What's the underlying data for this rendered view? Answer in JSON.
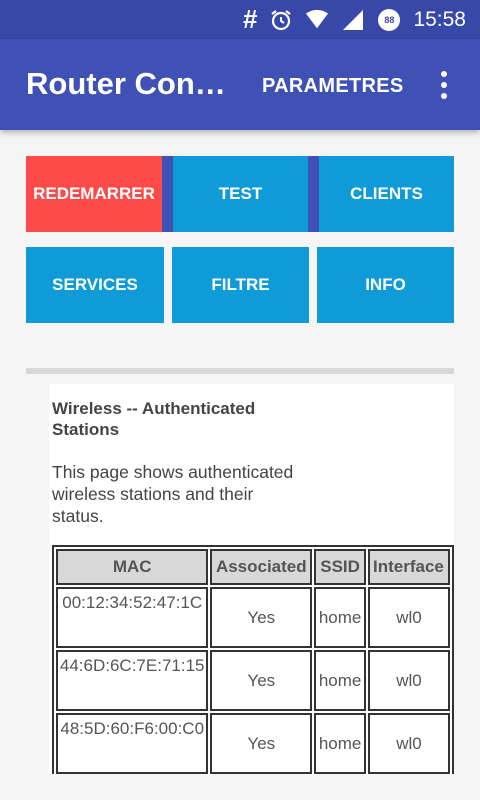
{
  "status_bar": {
    "notification_icon": "#",
    "battery_level": "88",
    "time": "15:58",
    "icons": [
      "hash-notification-icon",
      "alarm-icon",
      "wifi-icon",
      "cell-signal-icon",
      "battery-icon"
    ]
  },
  "app_bar": {
    "title": "Router Cont…",
    "action": "PARAMETRES",
    "overflow_icon": "more-vert-icon",
    "color": "#3f51b5"
  },
  "buttons": [
    {
      "label": "REDEMARRER",
      "color": "#ff4a4a"
    },
    {
      "label": "TEST",
      "color": "#0f9bd7"
    },
    {
      "label": "CLIENTS",
      "color": "#0f9bd7"
    },
    {
      "label": "SERVICES",
      "color": "#0f9bd7"
    },
    {
      "label": "FILTRE",
      "color": "#0f9bd7"
    },
    {
      "label": "INFO",
      "color": "#0f9bd7"
    }
  ],
  "webview": {
    "title": "Wireless -- Authenticated Stations",
    "description": "This page shows authenticated wireless stations and their status.",
    "table": {
      "headers": [
        "MAC",
        "Associated",
        "SSID",
        "Interface"
      ],
      "rows": [
        [
          "00:12:34:52:47:1C",
          "Yes",
          "home",
          "wl0"
        ],
        [
          "44:6D:6C:7E:71:15",
          "Yes",
          "home",
          "wl0"
        ],
        [
          "48:5D:60:F6:00:C0",
          "Yes",
          "home",
          "wl0"
        ]
      ]
    }
  }
}
